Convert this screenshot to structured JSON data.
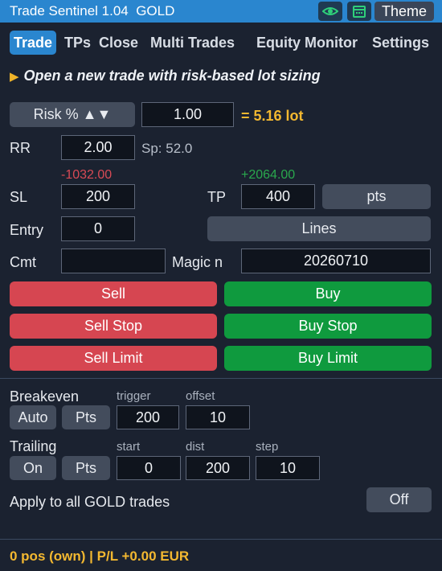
{
  "window": {
    "title": "Trade Sentinel 1.04",
    "symbol": "GOLD",
    "theme_label": "Theme",
    "icons": [
      "eye-icon",
      "calendar-icon"
    ]
  },
  "tabs": [
    {
      "label": "Trade",
      "active": true
    },
    {
      "label": "TPs",
      "active": false
    },
    {
      "label": "Close",
      "active": false
    },
    {
      "label": "Multi Trades",
      "active": false
    },
    {
      "label": "Equity Monitor",
      "active": false
    },
    {
      "label": "Settings",
      "active": false
    }
  ],
  "trade": {
    "heading": "Open a new trade with risk-based lot sizing",
    "risk_button": "Risk % ▲▼",
    "risk_value": "1.00",
    "lot_text": "= 5.16 lot",
    "rr_label": "RR",
    "rr_value": "2.00",
    "spread_text": "Sp: 52.0",
    "sl_money": "-1032.00",
    "tp_money": "+2064.00",
    "sl_label": "SL",
    "sl_value": "200",
    "tp_label": "TP",
    "tp_value": "400",
    "pts_button": "pts",
    "entry_label": "Entry",
    "entry_value": "0",
    "lines_button": "Lines",
    "cmt_label": "Cmt",
    "cmt_value": "",
    "magic_label": "Magic n",
    "magic_value": "20260710",
    "sell_label": "Sell",
    "buy_label": "Buy",
    "sell_stop_label": "Sell Stop",
    "buy_stop_label": "Buy Stop",
    "sell_limit_label": "Sell Limit",
    "buy_limit_label": "Buy Limit"
  },
  "breakeven": {
    "label": "Breakeven",
    "mode_button": "Auto",
    "unit_button": "Pts",
    "trigger_label": "trigger",
    "trigger_value": "200",
    "offset_label": "offset",
    "offset_value": "10"
  },
  "trailing": {
    "label": "Trailing",
    "mode_button": "On",
    "unit_button": "Pts",
    "start_label": "start",
    "start_value": "0",
    "dist_label": "dist",
    "dist_value": "200",
    "step_label": "step",
    "step_value": "10"
  },
  "apply_all": {
    "label": "Apply to all GOLD trades",
    "toggle": "Off"
  },
  "footer": {
    "status": "0 pos (own)  |  P/L +0.00 EUR"
  },
  "colors": {
    "accent": "#2a86cf",
    "sell": "#d64651",
    "buy": "#0f9a3e",
    "highlight": "#f3b830"
  }
}
